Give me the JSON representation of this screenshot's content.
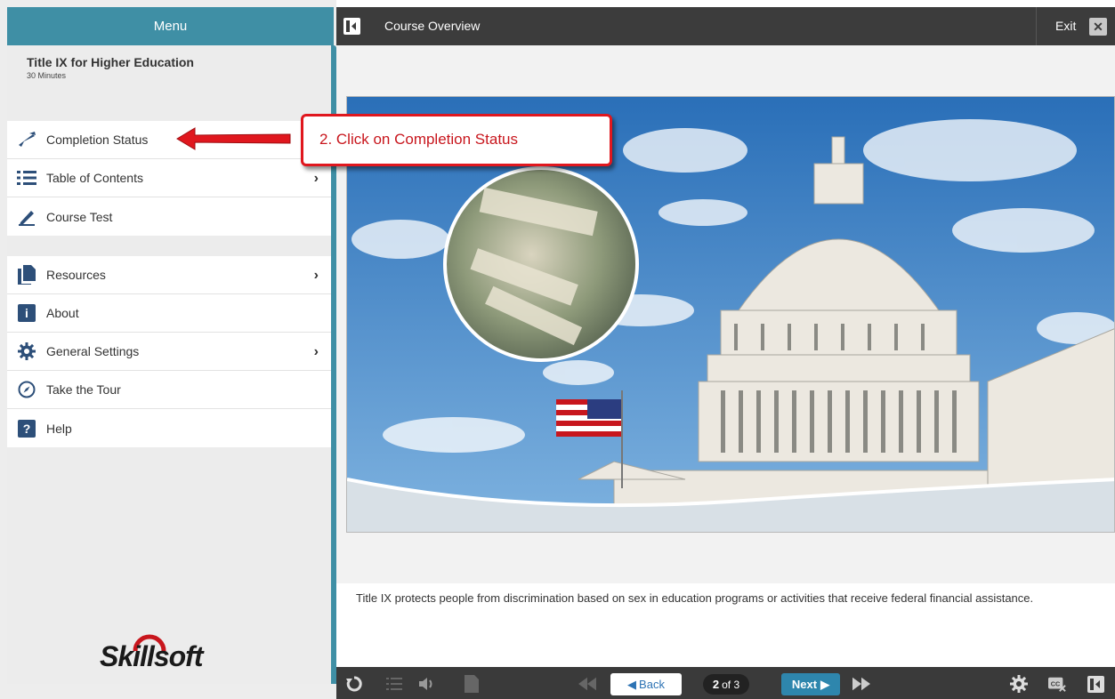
{
  "sidebar": {
    "header": "Menu",
    "course_title": "Title IX for Higher Education",
    "course_duration": "30 Minutes",
    "group1": [
      {
        "label": "Completion Status",
        "icon": "graduation-cap-icon"
      },
      {
        "label": "Table of Contents",
        "icon": "list-icon",
        "has_submenu": true
      },
      {
        "label": "Course Test",
        "icon": "pencil-icon"
      }
    ],
    "group2": [
      {
        "label": "Resources",
        "icon": "documents-icon",
        "has_submenu": true
      },
      {
        "label": "About",
        "icon": "info-icon"
      },
      {
        "label": "General Settings",
        "icon": "gear-icon",
        "has_submenu": true
      },
      {
        "label": "Take the Tour",
        "icon": "compass-icon"
      },
      {
        "label": "Help",
        "icon": "question-icon"
      }
    ],
    "logo": "Skillsoft"
  },
  "topbar": {
    "title": "Course Overview",
    "exit_label": "Exit"
  },
  "callout": {
    "text": "2. Click on Completion Status"
  },
  "slide": {
    "caption": "Title IX protects people from discrimination based on sex in education programs or activities that receive federal financial assistance."
  },
  "bottombar": {
    "back_label": "Back",
    "next_label": "Next",
    "page_current": "2",
    "page_total_text": "of 3"
  },
  "colors": {
    "accent": "#3f8fa5",
    "dark_bar": "#3c3c3c",
    "callout_red": "#e0171e",
    "icon_navy": "#2d4f79"
  }
}
